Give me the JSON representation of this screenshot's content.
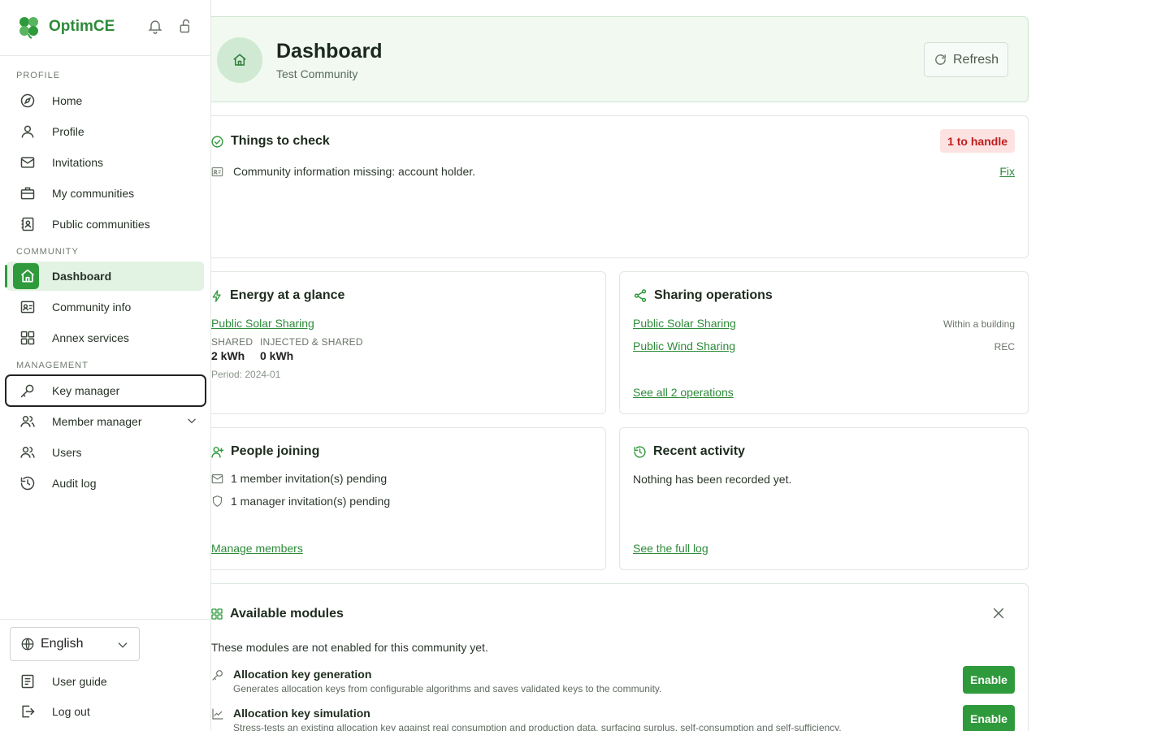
{
  "app": {
    "name": "OptimCE"
  },
  "sidebar": {
    "sections": {
      "profile": "PROFILE",
      "community": "COMMUNITY",
      "management": "MANAGEMENT"
    },
    "items": {
      "home": "Home",
      "profile": "Profile",
      "invitations": "Invitations",
      "my_communities": "My communities",
      "public_communities": "Public communities",
      "dashboard": "Dashboard",
      "community_info": "Community info",
      "annex_services": "Annex services",
      "key_manager": "Key manager",
      "member_manager": "Member manager",
      "users": "Users",
      "audit_log": "Audit log"
    },
    "language": "English",
    "user_guide": "User guide",
    "log_out": "Log out"
  },
  "header": {
    "title": "Dashboard",
    "subtitle": "Test Community",
    "refresh": "Refresh"
  },
  "things_to_check": {
    "title": "Things to check",
    "badge": "1 to handle",
    "item": "Community information missing: account holder.",
    "fix": "Fix"
  },
  "energy": {
    "title": "Energy at a glance",
    "link": "Public Solar Sharing",
    "shared_label": "SHARED",
    "shared_value": "2 kWh",
    "injected_label": "INJECTED & SHARED",
    "injected_value": "0 kWh",
    "period": "Period: 2024-01"
  },
  "sharing": {
    "title": "Sharing operations",
    "ops": [
      {
        "name": "Public Solar Sharing",
        "type": "Within a building"
      },
      {
        "name": "Public Wind Sharing",
        "type": "REC"
      }
    ],
    "see_all": "See all 2 operations"
  },
  "people": {
    "title": "People joining",
    "member_pending": "1 member invitation(s) pending",
    "manager_pending": "1 manager invitation(s) pending",
    "manage": "Manage members"
  },
  "activity": {
    "title": "Recent activity",
    "empty": "Nothing has been recorded yet.",
    "see_log": "See the full log"
  },
  "modules": {
    "title": "Available modules",
    "intro": "These modules are not enabled for this community yet.",
    "items": [
      {
        "title": "Allocation key generation",
        "desc": "Generates allocation keys from configurable algorithms and saves validated keys to the community.",
        "button": "Enable"
      },
      {
        "title": "Allocation key simulation",
        "desc": "Stress-tests an existing allocation key against real consumption and production data, surfacing surplus, self-consumption and self-sufficiency.",
        "button": "Enable"
      }
    ]
  },
  "colors": {
    "brand": "#2f9a3c",
    "badge_bg": "#fde2e2",
    "badge_text": "#c01d1d",
    "hero_bg": "#f1f9f1"
  }
}
